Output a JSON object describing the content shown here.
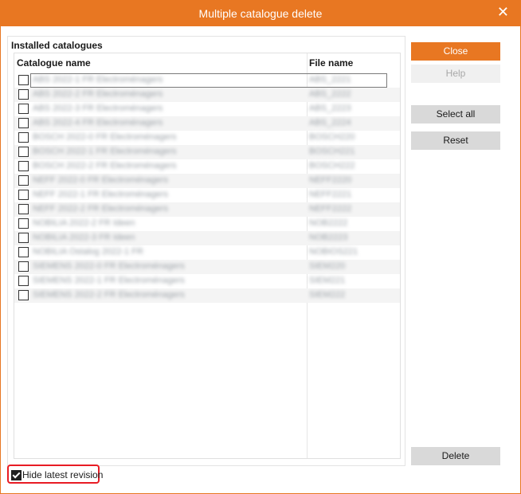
{
  "window": {
    "title": "Multiple catalogue delete",
    "close_glyph": "✕"
  },
  "group": {
    "label": "Installed catalogues"
  },
  "columns": {
    "name": "Catalogue name",
    "file": "File name"
  },
  "rows": [
    {
      "name": "ABS 2022-1 FR Electroménagers",
      "file": "ABS_2221"
    },
    {
      "name": "ABS 2022-2 FR Electroménagers",
      "file": "ABS_2222"
    },
    {
      "name": "ABS 2022-3 FR Electroménagers",
      "file": "ABS_2223"
    },
    {
      "name": "ABS 2022-4 FR Electroménagers",
      "file": "ABS_2224"
    },
    {
      "name": "BOSCH 2022-0 FR Electroménagers",
      "file": "BOSCH220"
    },
    {
      "name": "BOSCH 2022-1 FR Electroménagers",
      "file": "BOSCH221"
    },
    {
      "name": "BOSCH 2022-2 FR Electroménagers",
      "file": "BOSCH222"
    },
    {
      "name": "NEFF 2022-0 FR Electroménagers",
      "file": "NEFF2220"
    },
    {
      "name": "NEFF 2022-1 FR Electroménagers",
      "file": "NEFF2221"
    },
    {
      "name": "NEFF 2022-2 FR Electroménagers",
      "file": "NEFF2222"
    },
    {
      "name": "NOBILIA 2022-2 FR Ideen",
      "file": "NOB2222"
    },
    {
      "name": "NOBILIA 2022-3 FR Ideen",
      "file": "NOB2223"
    },
    {
      "name": "NOBILIA Ostalog 2022-1 FR",
      "file": "NOBIOS221"
    },
    {
      "name": "SIEMENS 2022-0 FR Electroménagers",
      "file": "SIEM220"
    },
    {
      "name": "SIEMENS 2022-1 FR Electroménagers",
      "file": "SIEM221"
    },
    {
      "name": "SIEMENS 2022-2 FR Electroménagers",
      "file": "SIEM222"
    }
  ],
  "buttons": {
    "close": "Close",
    "help": "Help",
    "select_all": "Select all",
    "reset": "Reset",
    "delete": "Delete"
  },
  "options": {
    "hide_latest_revision": "Hide latest revision",
    "hide_latest_revision_checked": true
  },
  "colors": {
    "accent": "#e87722",
    "highlight_border": "#e81c24"
  }
}
